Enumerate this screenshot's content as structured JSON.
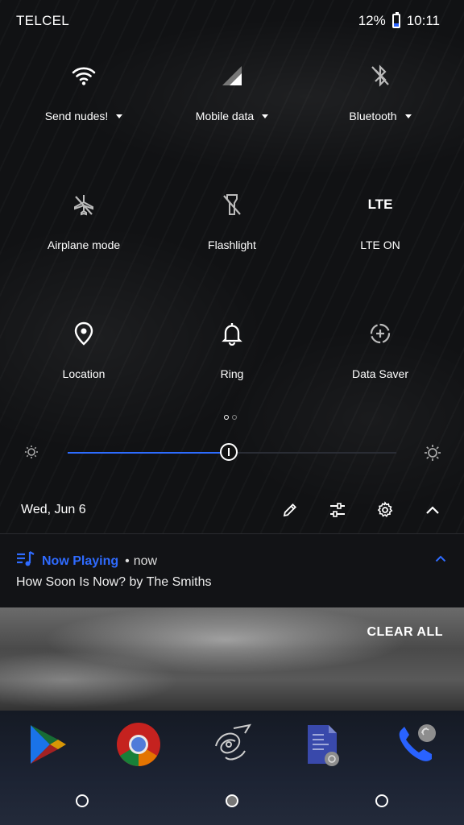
{
  "status_bar": {
    "carrier": "TELCEL",
    "battery": "12%",
    "time": "10:11"
  },
  "tiles": [
    {
      "label": "Send nudes!",
      "icon": "wifi-icon",
      "dropdown": true
    },
    {
      "label": "Mobile data",
      "icon": "signal-icon",
      "dropdown": true
    },
    {
      "label": "Bluetooth",
      "icon": "bluetooth-off-icon",
      "dropdown": true
    },
    {
      "label": "Airplane mode",
      "icon": "airplane-off-icon"
    },
    {
      "label": "Flashlight",
      "icon": "flashlight-off-icon"
    },
    {
      "label": "LTE ON",
      "icon": "lte-icon",
      "icon_text": "LTE"
    },
    {
      "label": "Location",
      "icon": "location-icon"
    },
    {
      "label": "Ring",
      "icon": "bell-icon"
    },
    {
      "label": "Data Saver",
      "icon": "data-saver-icon"
    }
  ],
  "pager": {
    "page": 1,
    "pages": 2
  },
  "brightness": {
    "level": 0.49,
    "accent": "#2d6cff"
  },
  "footer": {
    "date": "Wed, Jun 6"
  },
  "notification": {
    "app": "Now Playing",
    "separator": "•",
    "time": "now",
    "text": "How Soon Is Now? by The Smiths",
    "accent": "#2f6bff"
  },
  "clear_all": "CLEAR ALL",
  "dock": [
    "play-store-icon",
    "chrome-icon",
    "app-logo-icon",
    "files-icon",
    "phone-icon"
  ]
}
